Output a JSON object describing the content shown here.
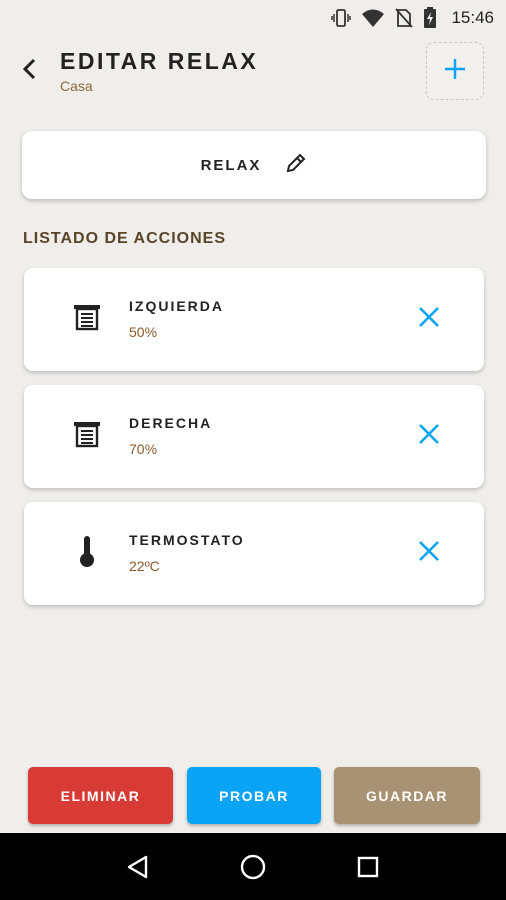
{
  "status_bar": {
    "time": "15:46",
    "icons": [
      "vibrate-icon",
      "wifi-icon",
      "no-sim-icon",
      "battery-charging-icon"
    ]
  },
  "header": {
    "title": "EDITAR RELAX",
    "subtitle": "Casa",
    "back_icon": "chevron-left-icon",
    "add_icon": "plus-icon"
  },
  "scene": {
    "name": "RELAX",
    "edit_icon": "pencil-icon"
  },
  "section": {
    "title": "LISTADO DE ACCIONES"
  },
  "actions": [
    {
      "name": "IZQUIERDA",
      "value": "50%",
      "icon": "blind-icon"
    },
    {
      "name": "DERECHA",
      "value": "70%",
      "icon": "blind-icon"
    },
    {
      "name": "TERMOSTATO",
      "value": "22ºC",
      "icon": "thermometer-icon"
    }
  ],
  "buttons": {
    "delete_label": "ELIMINAR",
    "test_label": "PROBAR",
    "save_label": "GUARDAR"
  },
  "colors": {
    "accent_blue": "#0aa3f5",
    "danger_red": "#d83a35",
    "save_brown": "#a89274",
    "subtitle_brown": "#8a6a3a",
    "background": "#efeeeb"
  },
  "nav_bar": {
    "icons": [
      "back-triangle-icon",
      "home-circle-icon",
      "recents-square-icon"
    ]
  }
}
